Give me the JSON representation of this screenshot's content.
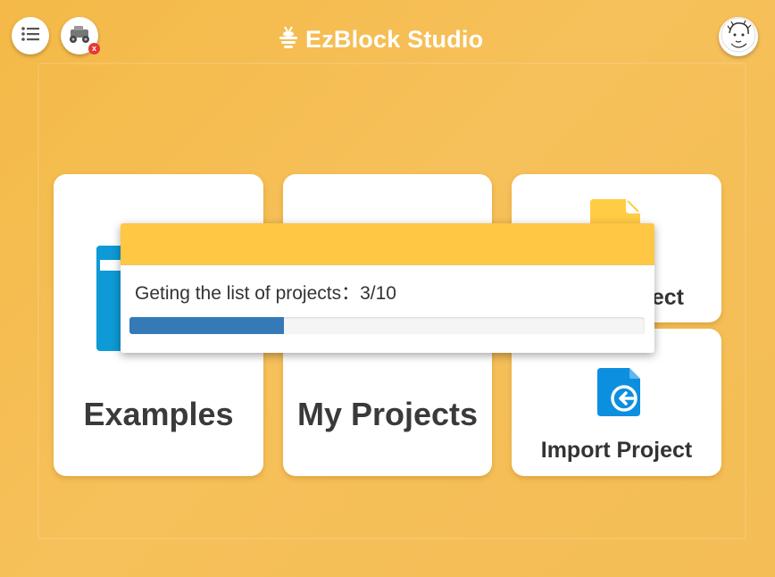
{
  "header": {
    "title": "EzBlock Studio",
    "menu_icon": "list-icon",
    "device_icon": "robot-car-icon",
    "device_status": "disconnected",
    "device_badge": "x",
    "avatar_icon": "user-avatar-icon"
  },
  "cards": {
    "examples": {
      "label": "Examples",
      "icon": "examples-window-icon"
    },
    "my_projects": {
      "label": "My Projects",
      "icon": "folder-icon"
    },
    "new_project": {
      "label": "New Project",
      "visible_label": "ect",
      "icon": "new-file-icon"
    },
    "import_project": {
      "label": "Import Project",
      "icon": "import-file-icon"
    }
  },
  "dialog": {
    "message": "Geting the list of projects：3/10",
    "progress_current": 3,
    "progress_total": 10,
    "progress_fraction": 0.3
  },
  "colors": {
    "background": "#f4b947",
    "dialog_header": "#ffc743",
    "progress": "#337ab7",
    "icon_blue": "#0d8fe0",
    "icon_yellow": "#ffcc44"
  }
}
